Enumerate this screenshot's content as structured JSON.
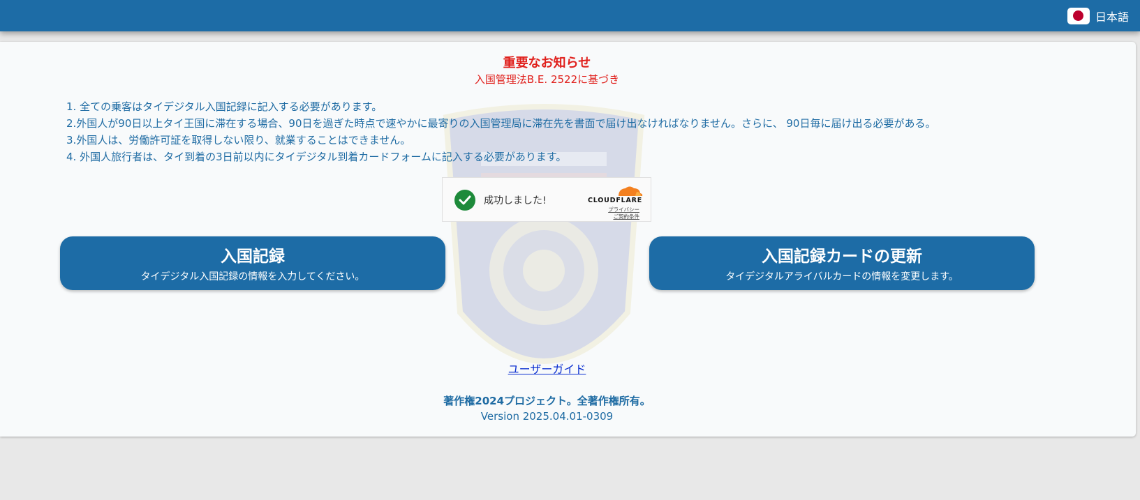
{
  "header": {
    "language": "日本語",
    "flag_icon": "japan-flag-icon",
    "bar_color": "#1d6ca6"
  },
  "notice": {
    "title": "重要なお知らせ",
    "subtitle": "入国管理法B.E. 2522に基づき",
    "items": [
      "1. 全ての乗客はタイデジタル入国記録に記入する必要があります。",
      "2.外国人が90日以上タイ王国に滞在する場合、90日を過ぎた時点で速やかに最寄りの入国管理局に滞在先を書面で届け出なければなりません。さらに、 90日毎に届け出る必要がある。",
      "3.外国人は、労働許可証を取得しない限り、就業することはできません。",
      "4. 外国人旅行者は、タイ到着の3日前以内にタイデジタル到着カードフォームに記入する必要があります。"
    ]
  },
  "captcha": {
    "status": "成功しました!",
    "brand": "CLOUDFLARE",
    "privacy_link": "プライバシー",
    "terms_link": "ご契約条件",
    "status_icon": "checkmark-circle-icon",
    "status_color": "#1d8a3a"
  },
  "actions": {
    "arrival": {
      "title": "入国記録",
      "subtitle": "タイデジタル入国記録の情報を入力してください。"
    },
    "update": {
      "title": "入国記録カードの更新",
      "subtitle": "タイデジタルアライバルカードの情報を変更します。"
    }
  },
  "footer": {
    "guide_link": "ユーザーガイド",
    "copyright": "著作権2024プロジェクト。全著作権所有。",
    "version": "Version 2025.04.01-0309"
  },
  "colors": {
    "primary": "#1d6ca6",
    "alert": "#e0201c",
    "text": "#1e6ba3",
    "link": "#0b2fd0"
  }
}
